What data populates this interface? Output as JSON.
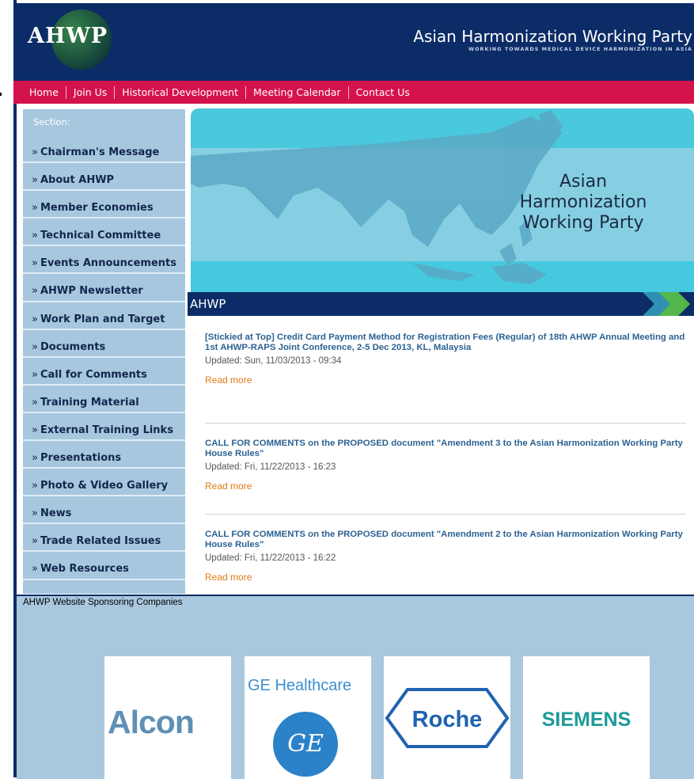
{
  "header": {
    "logo_text": "AHWP",
    "site_title": "Asian Harmonization Working Party",
    "site_tagline": "WORKING TOWARDS MEDICAL DEVICE HARMONIZATION IN ASIA"
  },
  "nav": {
    "items": [
      {
        "label": "Home"
      },
      {
        "label": "Join Us"
      },
      {
        "label": "Historical Development"
      },
      {
        "label": "Meeting Calendar"
      },
      {
        "label": "Contact Us"
      }
    ]
  },
  "sidebar": {
    "heading": "Section:",
    "items": [
      {
        "label": "Chairman's Message"
      },
      {
        "label": "About AHWP"
      },
      {
        "label": "Member Economies"
      },
      {
        "label": "Technical Committee"
      },
      {
        "label": "Events Announcements"
      },
      {
        "label": "AHWP Newsletter"
      },
      {
        "label": "Work Plan and Target"
      },
      {
        "label": "Documents"
      },
      {
        "label": "Call for Comments"
      },
      {
        "label": "Training Material"
      },
      {
        "label": "External Training Links"
      },
      {
        "label": "Presentations"
      },
      {
        "label": "Photo & Video Gallery"
      },
      {
        "label": "News"
      },
      {
        "label": "Trade Related Issues"
      },
      {
        "label": "Web Resources"
      }
    ],
    "bullet": "»"
  },
  "banner": {
    "line1": "Asian",
    "line2": "Harmonization",
    "line3": "Working Party"
  },
  "section": {
    "title": "AHWP"
  },
  "articles": [
    {
      "title": "[Stickied at Top] Credit Card Payment Method for Registration Fees (Regular) of 18th AHWP Annual Meeting and 1st AHWP-RAPS Joint Conference, 2-5 Dec 2013, KL, Malaysia",
      "updated": "Updated: Sun, 11/03/2013 - 09:34",
      "read_more": "Read more"
    },
    {
      "title": "CALL FOR COMMENTS on the PROPOSED document \"Amendment 3 to the Asian Harmonization Working Party House Rules\"",
      "updated": "Updated: Fri, 11/22/2013 - 16:23",
      "read_more": "Read more"
    },
    {
      "title": "CALL FOR COMMENTS on the PROPOSED document \"Amendment 2 to the Asian Harmonization Working Party House Rules\"",
      "updated": "Updated: Fri, 11/22/2013 - 16:22",
      "read_more": "Read more"
    }
  ],
  "footer": {
    "title": "AHWP Website Sponsoring Companies",
    "sponsors": [
      {
        "name": "Alcon",
        "logo_icon": "alcon-logo"
      },
      {
        "name": "GE Healthcare",
        "badge": "GE",
        "logo_icon": "ge-logo"
      },
      {
        "name": "Roche",
        "logo_icon": "roche-logo"
      },
      {
        "name": "SIEMENS",
        "logo_icon": "siemens-logo"
      }
    ]
  },
  "colors": {
    "header_bg": "#0b2c66",
    "nav_bg": "#d4134c",
    "sidebar_bg": "#a7c7de",
    "link_blue": "#2b6292",
    "read_more_orange": "#e07a14"
  }
}
